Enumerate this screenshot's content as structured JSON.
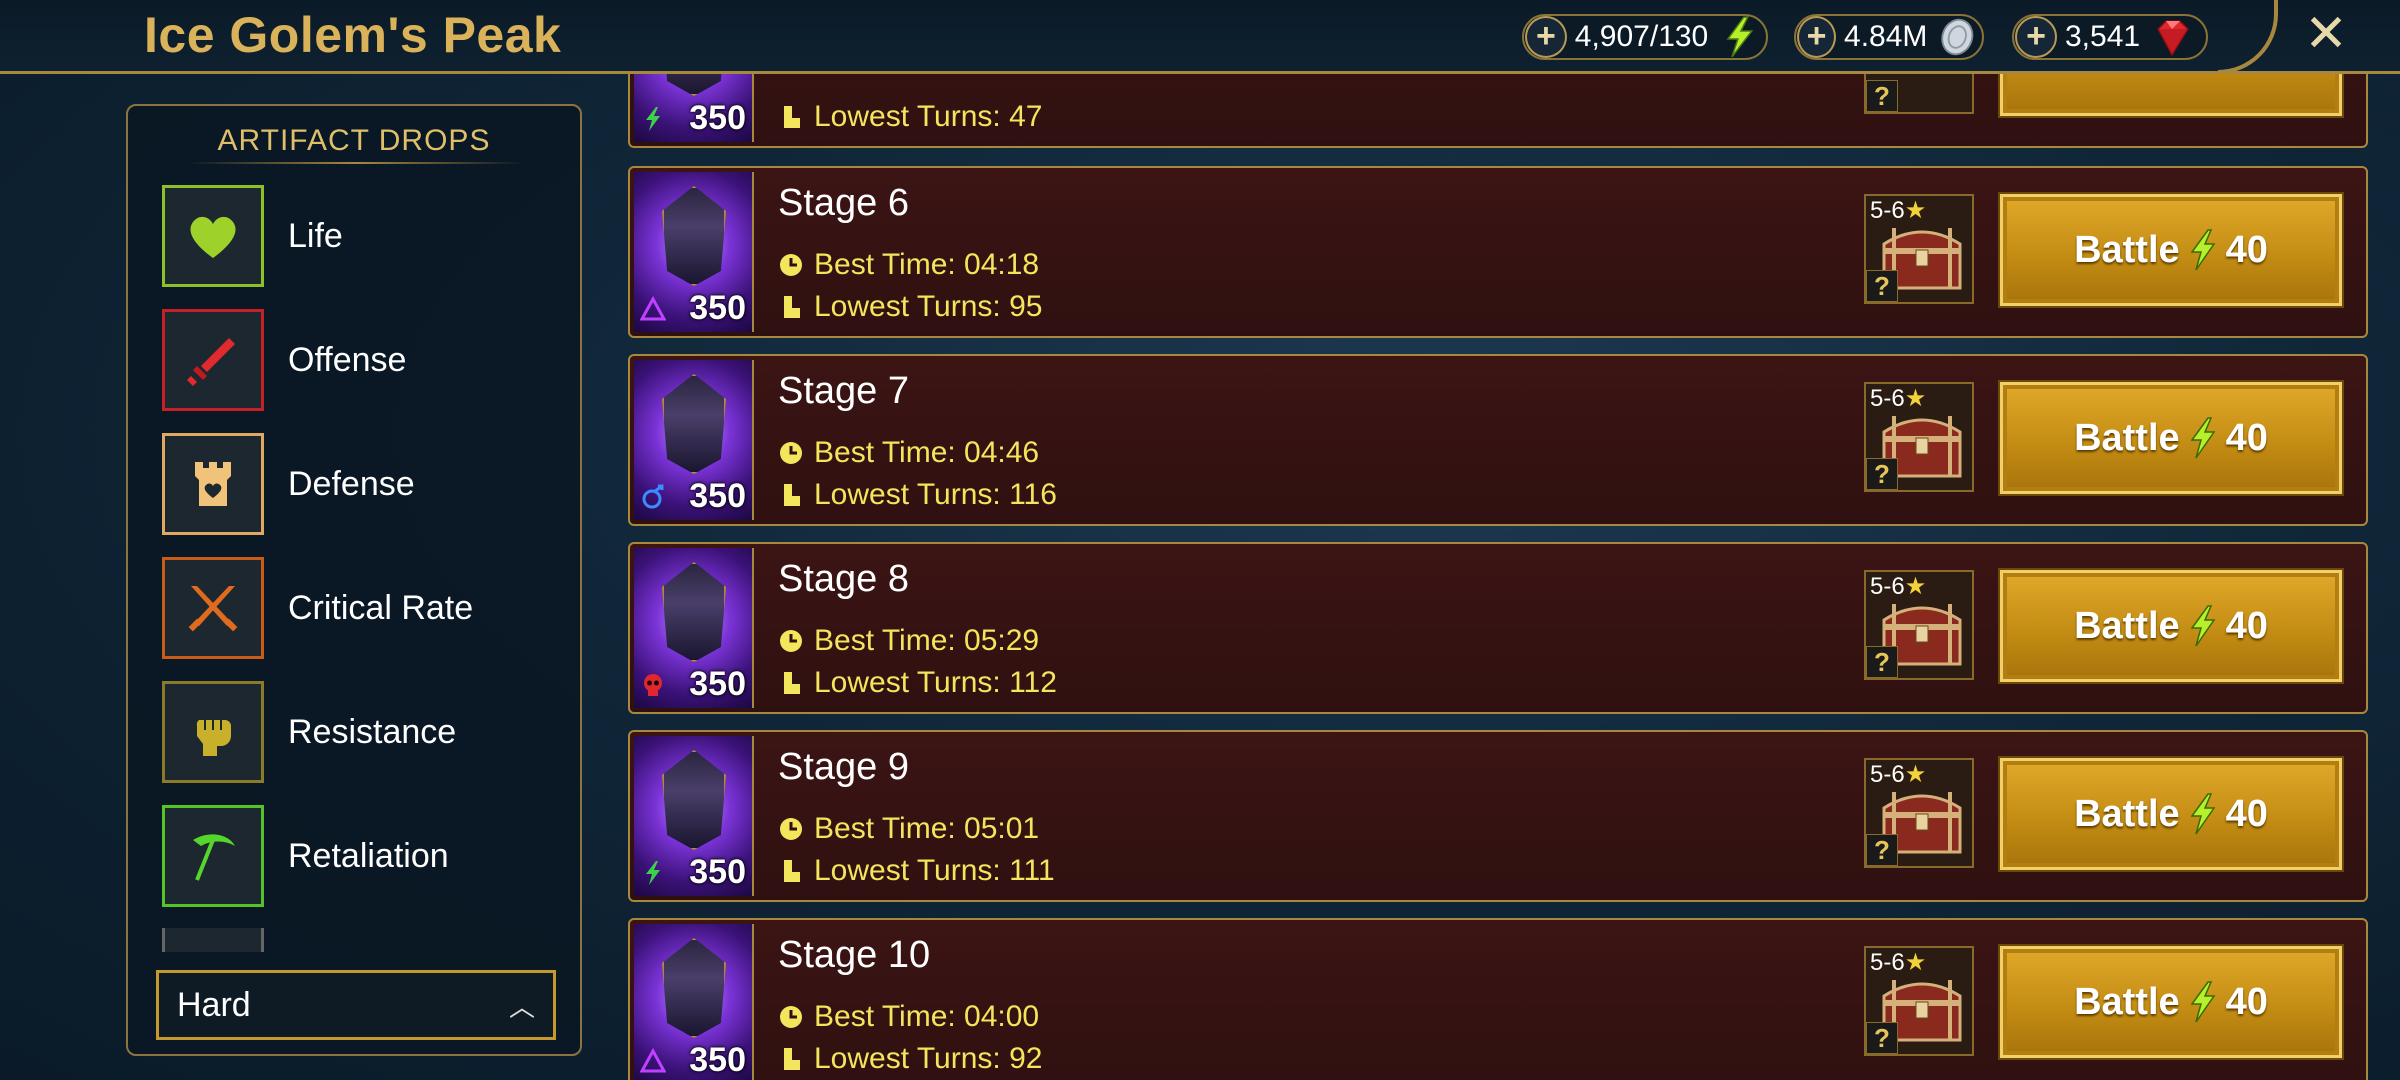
{
  "header": {
    "title": "Ice Golem's Peak",
    "energy": "4,907/130",
    "silver": "4.84M",
    "gems": "3,541",
    "close_icon": "close-icon"
  },
  "artifact_drops": {
    "title": "ARTIFACT DROPS",
    "items": [
      {
        "label": "Life",
        "icon": "heart-icon",
        "color": "#9ed12a"
      },
      {
        "label": "Offense",
        "icon": "sword-icon",
        "color": "#d8262a"
      },
      {
        "label": "Defense",
        "icon": "tower-icon",
        "color": "#f0c27a"
      },
      {
        "label": "Critical Rate",
        "icon": "crossed-swords-icon",
        "color": "#e06a1e"
      },
      {
        "label": "Resistance",
        "icon": "fist-icon",
        "color": "#c9b02a"
      },
      {
        "label": "Retaliation",
        "icon": "scythe-icon",
        "color": "#55d62a"
      }
    ]
  },
  "difficulty": {
    "value": "Hard"
  },
  "partial_stage": {
    "level": "350",
    "lowest_turns": "Lowest Turns: 47"
  },
  "stages": [
    {
      "name": "Stage 6",
      "level": "350",
      "affinity": "void",
      "best_time": "Best Time: 04:18",
      "lowest_turns": "Lowest Turns: 95",
      "rank": "5-6",
      "battle_label": "Battle",
      "energy_cost": "40"
    },
    {
      "name": "Stage 7",
      "level": "350",
      "affinity": "magic",
      "best_time": "Best Time: 04:46",
      "lowest_turns": "Lowest Turns: 116",
      "rank": "5-6",
      "battle_label": "Battle",
      "energy_cost": "40"
    },
    {
      "name": "Stage 8",
      "level": "350",
      "affinity": "force",
      "best_time": "Best Time: 05:29",
      "lowest_turns": "Lowest Turns: 112",
      "rank": "5-6",
      "battle_label": "Battle",
      "energy_cost": "40"
    },
    {
      "name": "Stage 9",
      "level": "350",
      "affinity": "spirit",
      "best_time": "Best Time: 05:01",
      "lowest_turns": "Lowest Turns: 111",
      "rank": "5-6",
      "battle_label": "Battle",
      "energy_cost": "40"
    },
    {
      "name": "Stage 10",
      "level": "350",
      "affinity": "void",
      "best_time": "Best Time: 04:00",
      "lowest_turns": "Lowest Turns: 92",
      "rank": "5-6",
      "battle_label": "Battle",
      "energy_cost": "40"
    }
  ],
  "colors": {
    "gold": "#d9b25a",
    "battle_button": "#c18a12",
    "stat_text": "#f3e55c",
    "row_bg": "#3c1414"
  }
}
